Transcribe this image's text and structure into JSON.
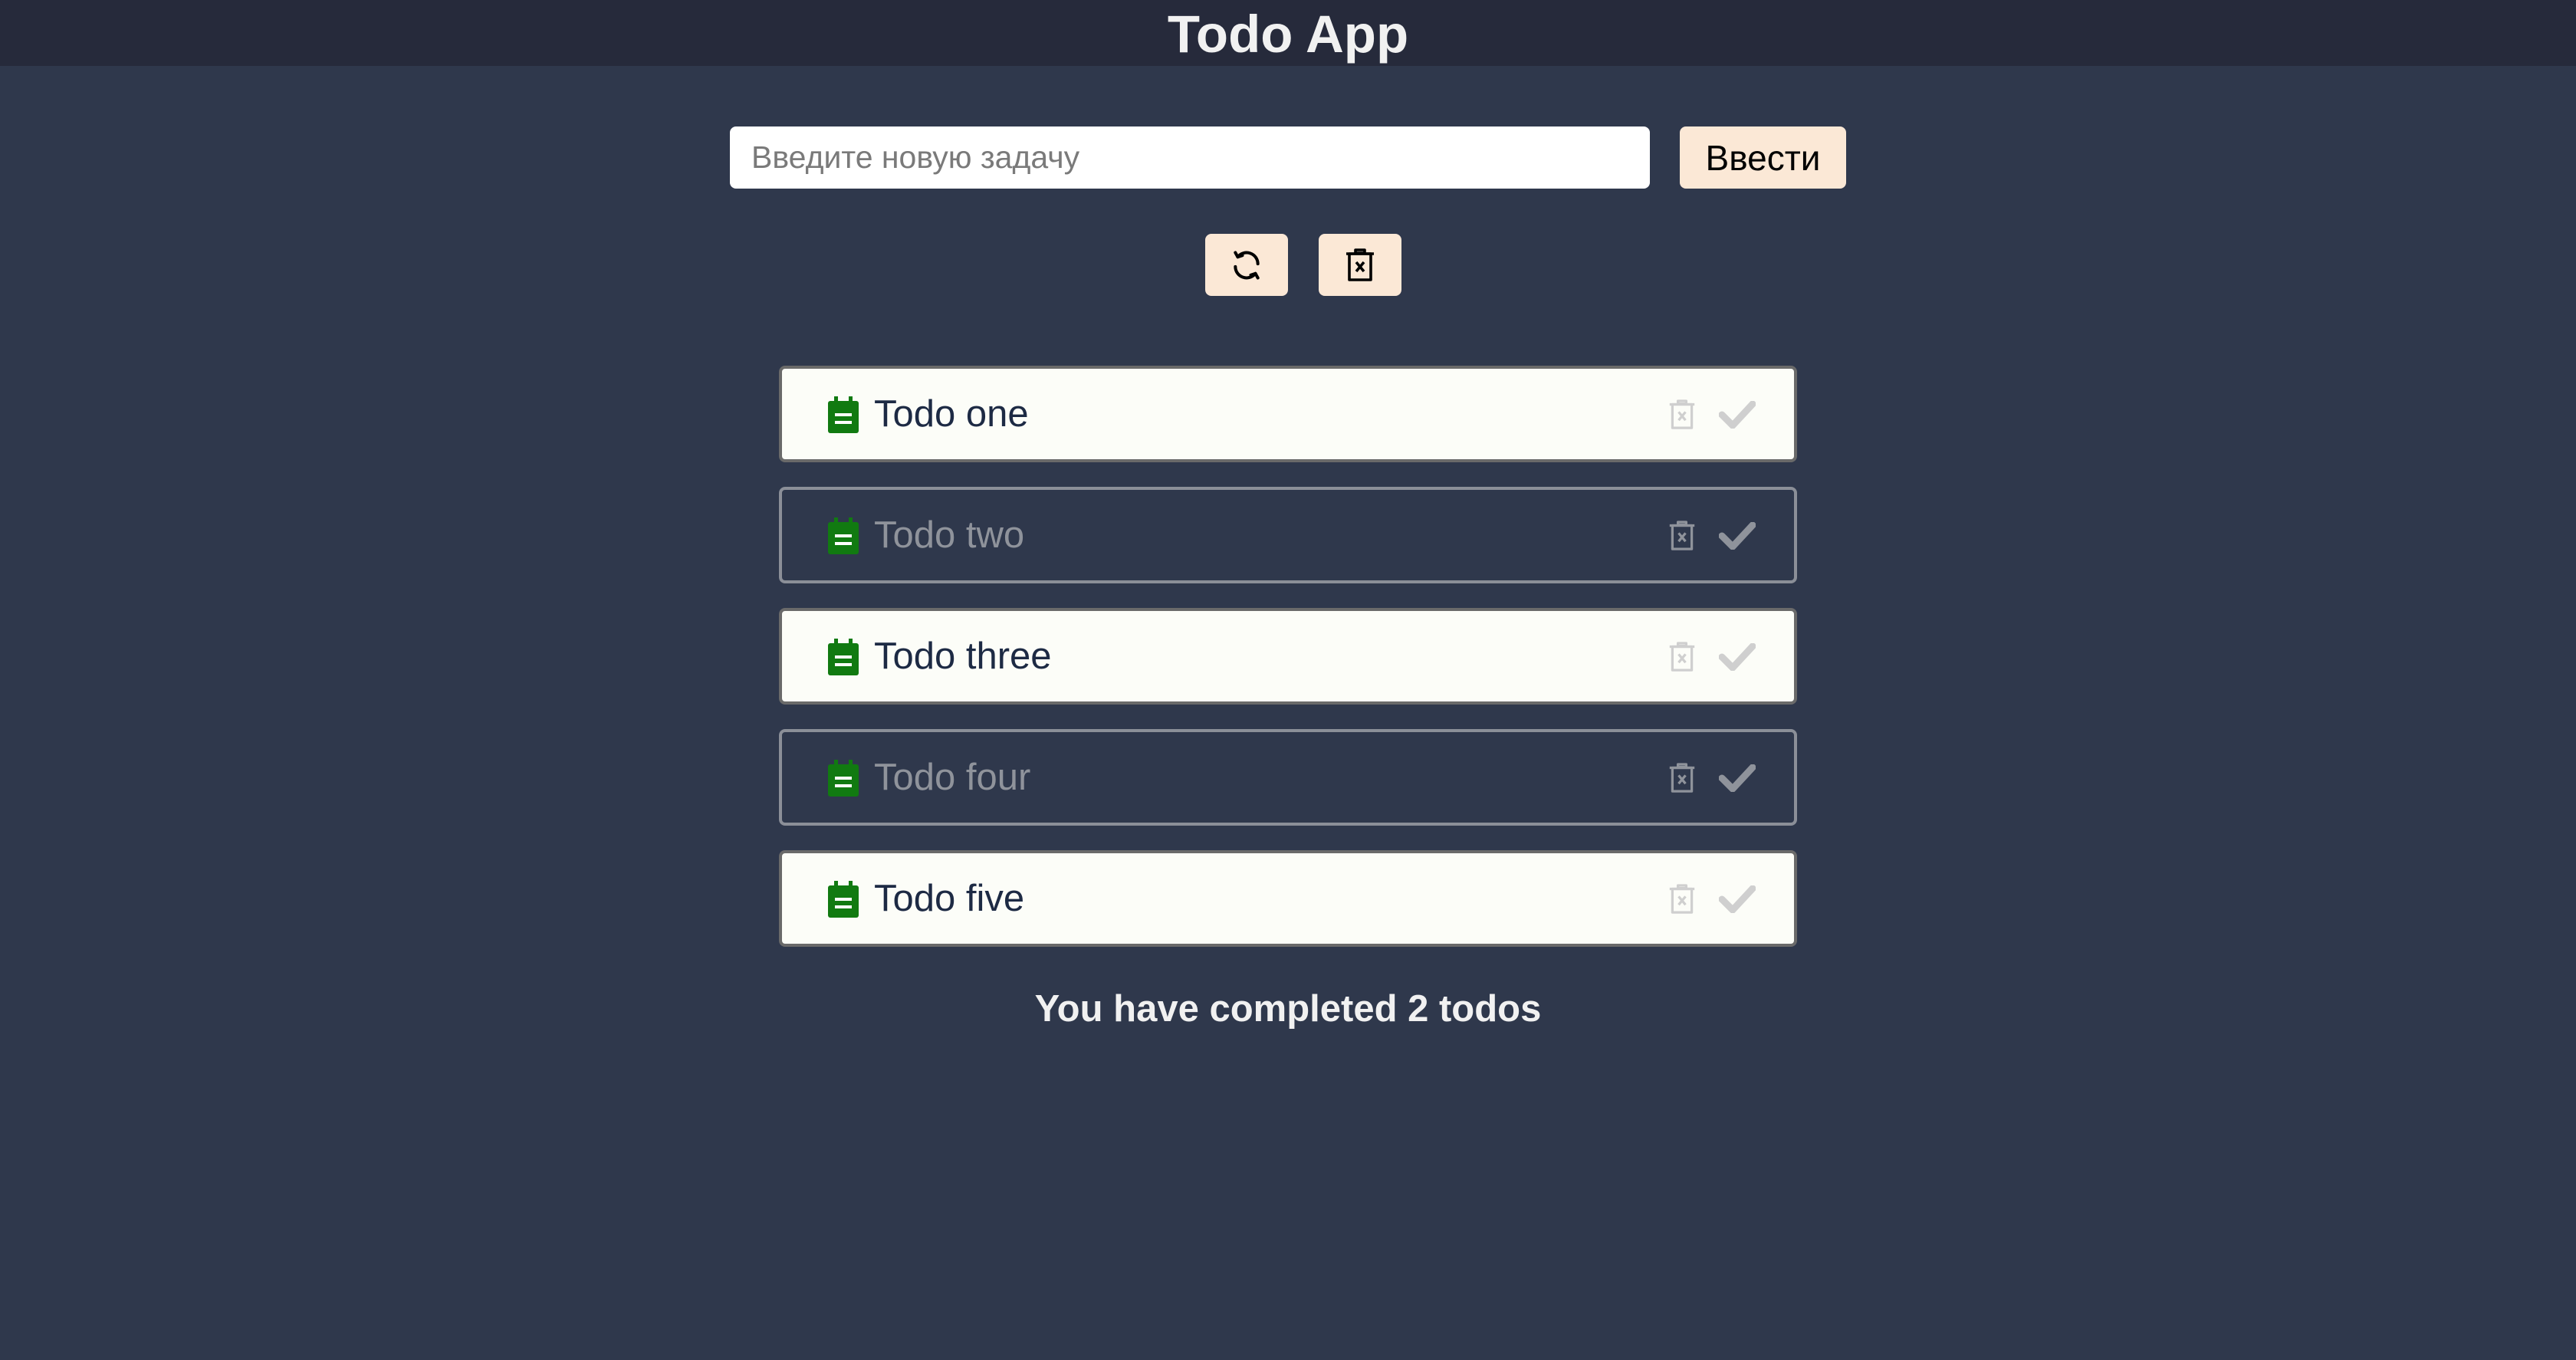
{
  "app": {
    "title": "Todo App"
  },
  "form": {
    "input_placeholder": "Введите новую задачу",
    "input_value": "",
    "submit_label": "Ввести"
  },
  "toolbar": {
    "refresh_icon": "refresh-icon",
    "clear_all_icon": "trash-x-icon"
  },
  "todos": [
    {
      "text": "Todo one",
      "completed": false
    },
    {
      "text": "Todo two",
      "completed": true
    },
    {
      "text": "Todo three",
      "completed": false
    },
    {
      "text": "Todo four",
      "completed": true
    },
    {
      "text": "Todo five",
      "completed": false
    }
  ],
  "summary": "You have completed 2 todos",
  "colors": {
    "background": "#2f384c",
    "header": "#262a3b",
    "button": "#fbe8d6",
    "card": "#fcfdf8",
    "note_icon": "#117a11"
  }
}
